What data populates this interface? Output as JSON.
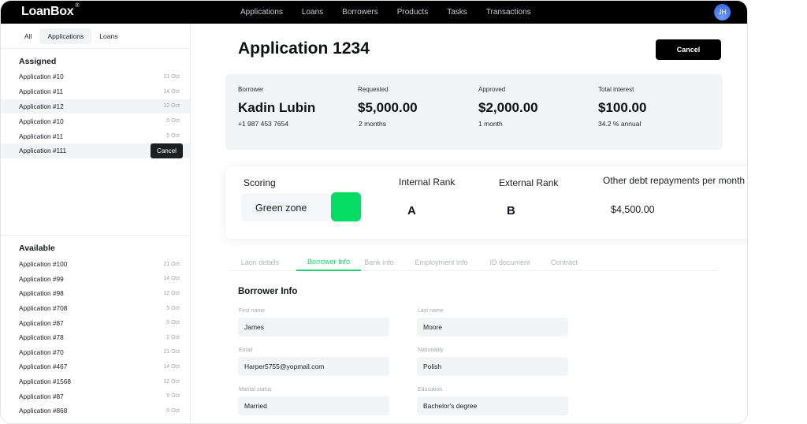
{
  "app": {
    "brand": "LoanBox",
    "brand_mark": "®",
    "nav": [
      "Applications",
      "Loans",
      "Borrowers",
      "Products",
      "Tasks",
      "Transactions"
    ],
    "user_initials": "JH"
  },
  "sidebar": {
    "filters": [
      {
        "label": "All",
        "active": false
      },
      {
        "label": "Applications",
        "active": true
      },
      {
        "label": "Loans",
        "active": false
      }
    ],
    "assigned": {
      "title": "Assigned",
      "items": [
        {
          "name": "Application #10",
          "date": "21 Oct"
        },
        {
          "name": "Application #11",
          "date": "14 Oct"
        },
        {
          "name": "Application #12",
          "date": "12 Oct"
        },
        {
          "name": "Application #10",
          "date": "5 Oct"
        },
        {
          "name": "Application #11",
          "date": "5 Oct"
        },
        {
          "name": "Application #111",
          "date": ""
        }
      ],
      "row_action_label": "Cancel"
    },
    "available": {
      "title": "Available",
      "items": [
        {
          "name": "Application #100",
          "date": "21 Oct"
        },
        {
          "name": "Application #99",
          "date": "14 Oct"
        },
        {
          "name": "Application #98",
          "date": "12 Oct"
        },
        {
          "name": "Application #708",
          "date": "5 Oct"
        },
        {
          "name": "Application #87",
          "date": "5 Oct"
        },
        {
          "name": "Application #78",
          "date": "2 Oct"
        },
        {
          "name": "Application #70",
          "date": "21 Oct"
        },
        {
          "name": "Application #467",
          "date": "14 Oct"
        },
        {
          "name": "Application #1568",
          "date": "12 Oct"
        },
        {
          "name": "Application #87",
          "date": "5 Oct"
        },
        {
          "name": "Application #868",
          "date": "5 Oct"
        }
      ]
    }
  },
  "main": {
    "title": "Application 1234",
    "cancel_label": "Cancel",
    "summary": {
      "borrower": {
        "label": "Borrower",
        "value": "Kadin Lubin",
        "sub": "+1 987 453 7654"
      },
      "requested": {
        "label": "Requested",
        "value": "$5,000.00",
        "sub": "2 months"
      },
      "approved": {
        "label": "Approved",
        "value": "$2,000.00",
        "sub": "1 month"
      },
      "interest": {
        "label": "Total interest",
        "value": "$100.00",
        "sub": "34.2 % annual"
      }
    },
    "scoring": {
      "label": "Scoring",
      "zone": "Green zone",
      "zone_color": "#06DB64",
      "internal_rank_label": "Internal Rank",
      "internal_rank": "A",
      "external_rank_label": "External Rank",
      "external_rank": "B",
      "debt_label": "Other debt repayments per month",
      "debt_value": "$4,500.00"
    },
    "tabs": [
      {
        "label": "Laon details",
        "active": false
      },
      {
        "label": "Borrower Info",
        "active": true
      },
      {
        "label": "Bank info",
        "active": false
      },
      {
        "label": "Employment info",
        "active": false
      },
      {
        "label": "ID document",
        "active": false
      },
      {
        "label": "Contract",
        "active": false
      }
    ],
    "form": {
      "title": "Borrower Info",
      "fields": {
        "first_name": {
          "label": "First name",
          "value": "James"
        },
        "last_name": {
          "label": "Last name",
          "value": "Moore"
        },
        "email": {
          "label": "Email",
          "value": "Harper5755@yopmail.com"
        },
        "nationality": {
          "label": "Nationality",
          "value": "Polish"
        },
        "marital_status": {
          "label": "Marital status",
          "value": "Married"
        },
        "education": {
          "label": "Education",
          "value": "Bachelor's degree"
        }
      }
    }
  },
  "colors": {
    "accent": "#1FD46A",
    "topbar": "#000000",
    "avatar": "#3A6FF0"
  }
}
